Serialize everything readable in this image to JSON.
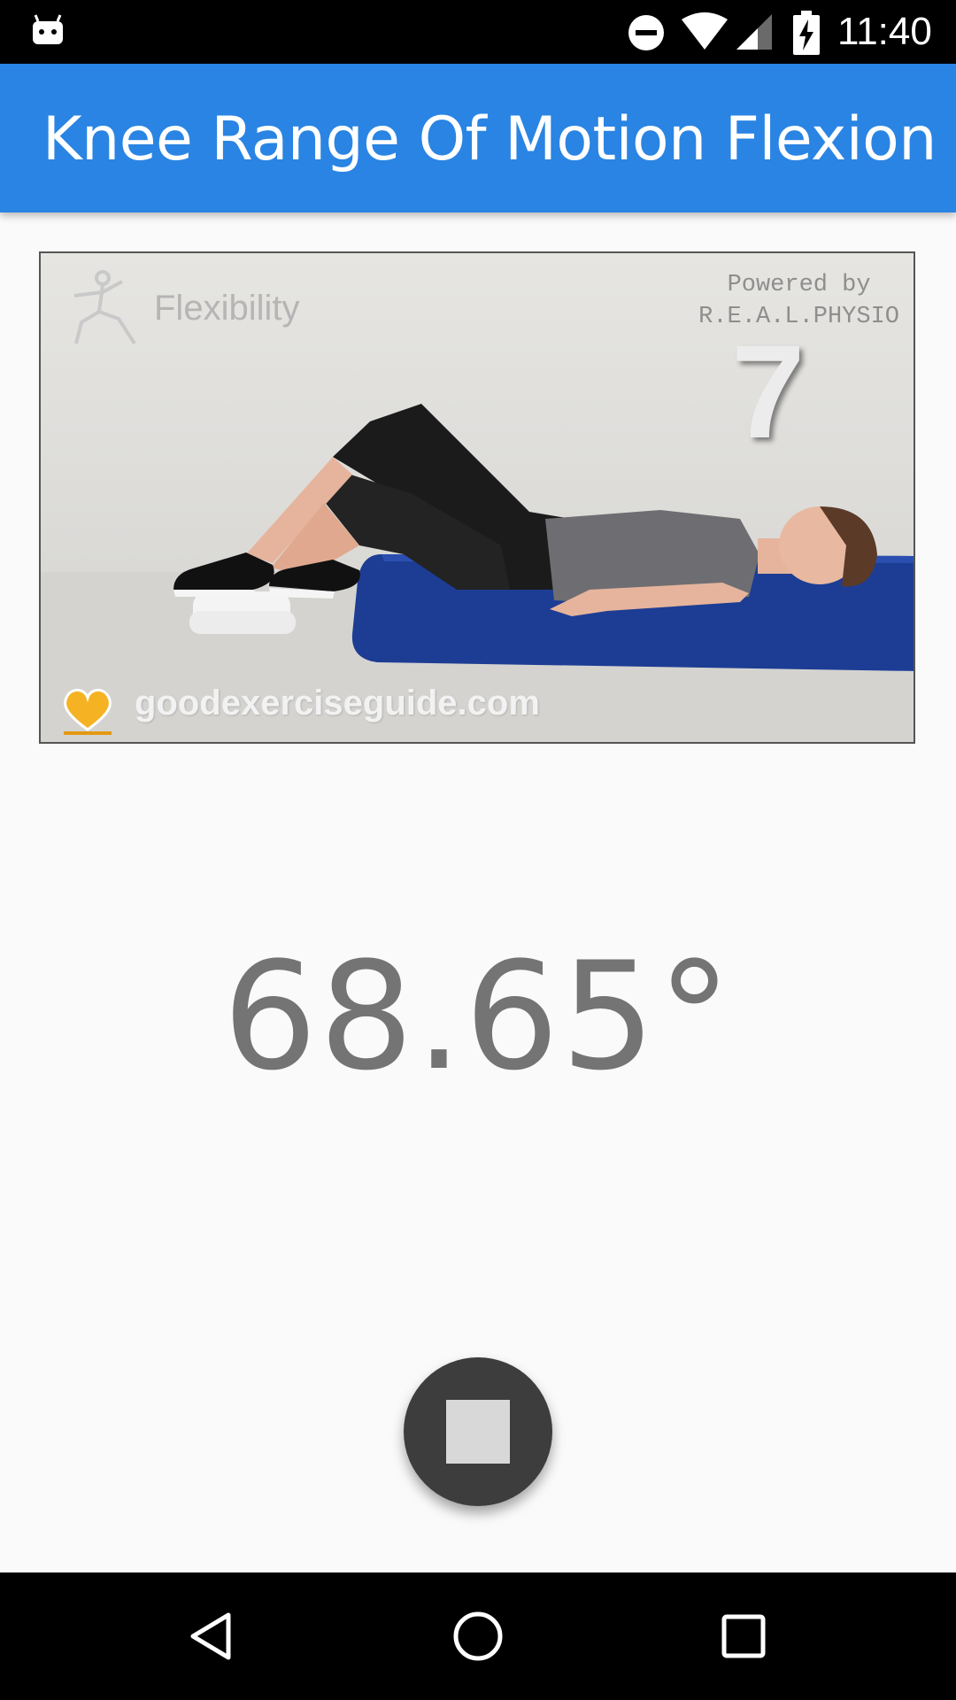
{
  "status_bar": {
    "time": "11:40",
    "icons": [
      "android-icon",
      "do-not-disturb-icon",
      "wifi-icon",
      "cell-signal-icon",
      "battery-charging-icon"
    ]
  },
  "app_bar": {
    "title": "Knee Range Of Motion Flexion"
  },
  "exercise_image": {
    "category": "Flexibility",
    "powered_by_line1": "Powered by",
    "powered_by_line2": "R.E.A.L.PHYSIO",
    "exercise_number": "7",
    "website": "goodexerciseguide.com",
    "icons": [
      "figure-icon",
      "heart-icon"
    ]
  },
  "angle": {
    "value": "68.65°"
  },
  "controls": {
    "stop_icon": "stop-icon"
  },
  "nav_bar": {
    "icons": [
      "back-icon",
      "home-icon",
      "recents-icon"
    ]
  },
  "colors": {
    "app_bar": "#2a84e3",
    "background": "#fafafa",
    "fab": "#3d3d3d",
    "angle_text": "#747474"
  }
}
